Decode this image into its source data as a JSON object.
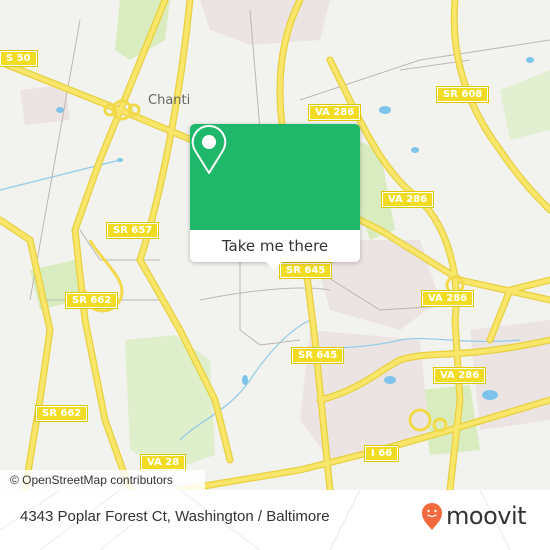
{
  "map": {
    "place_labels": [
      {
        "id": "chantilly",
        "text": "Chanti"
      }
    ],
    "road_shields": [
      {
        "id": "us50",
        "text": "S 50"
      },
      {
        "id": "va286-a",
        "text": "VA 286"
      },
      {
        "id": "sr608",
        "text": "SR 608"
      },
      {
        "id": "va286-b",
        "text": "VA 286"
      },
      {
        "id": "sr657",
        "text": "SR 657"
      },
      {
        "id": "sr645-a",
        "text": "SR 645"
      },
      {
        "id": "va286-c",
        "text": "VA 286"
      },
      {
        "id": "sr662-a",
        "text": "SR 662"
      },
      {
        "id": "sr645-b",
        "text": "SR 645"
      },
      {
        "id": "va286-d",
        "text": "VA 286"
      },
      {
        "id": "sr662-b",
        "text": "SR 662"
      },
      {
        "id": "va28",
        "text": "VA 28"
      },
      {
        "id": "i66",
        "text": "I 66"
      }
    ],
    "attribution": "© OpenStreetMap contributors",
    "colors": {
      "land": "#f2f2ee",
      "park": "#d9ecc0",
      "residential": "#ece4e2",
      "water": "#7ec4ea",
      "highway": "#f5e260",
      "highway_casing": "#e8d040",
      "minor_road": "#b8b4b0"
    }
  },
  "popup": {
    "icon": "location-pin-icon",
    "button_label": "Take me there",
    "color": "#1fb86b"
  },
  "footer": {
    "address": "4343 Poplar Forest Ct, Washington / Baltimore",
    "brand": "moovit",
    "brand_color": "#f26a3d"
  }
}
